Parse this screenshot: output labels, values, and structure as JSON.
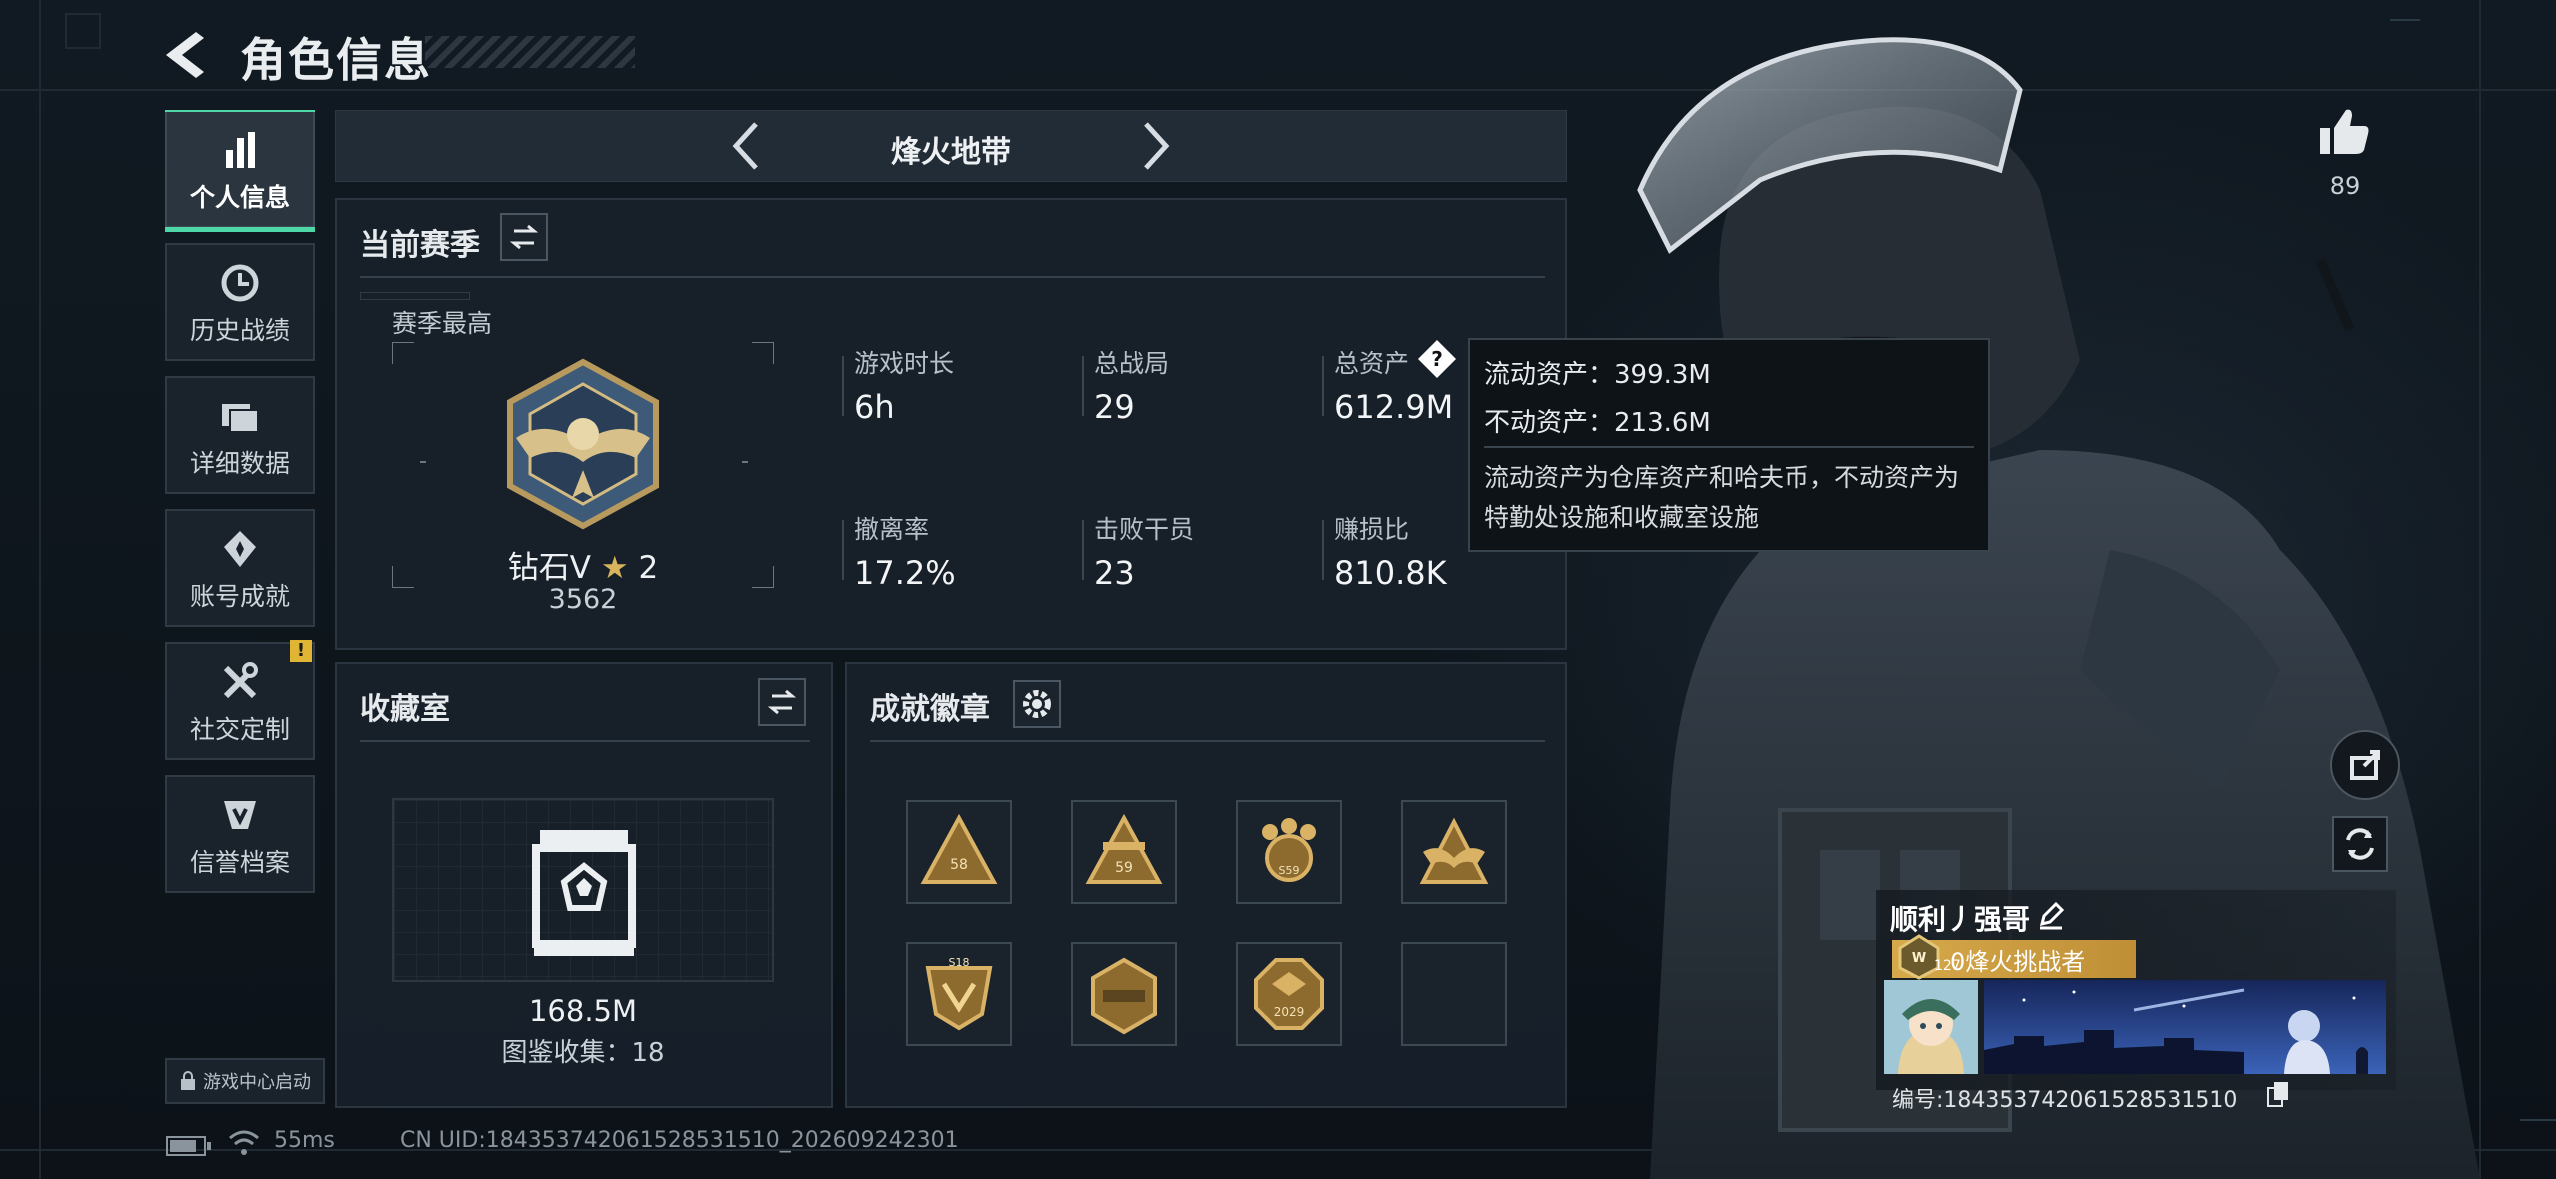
{
  "header": {
    "title": "角色信息"
  },
  "nav": {
    "items": [
      {
        "label": "个人信息"
      },
      {
        "label": "历史战绩"
      },
      {
        "label": "详细数据"
      },
      {
        "label": "账号成就"
      },
      {
        "label": "社交定制"
      },
      {
        "label": "信誉档案"
      }
    ],
    "alert": "!",
    "game_center": "游戏中心启动"
  },
  "mode": {
    "name": "烽火地带"
  },
  "season": {
    "title": "当前赛季",
    "best_label": "赛季最高",
    "rank_name": "钻石V",
    "rank_stars": "2",
    "rank_score": "3562",
    "stats": [
      {
        "label": "游戏时长",
        "value": "6h"
      },
      {
        "label": "总战局",
        "value": "29"
      },
      {
        "label": "总资产",
        "value": "612.9M"
      },
      {
        "label": "撤离率",
        "value": "17.2%"
      },
      {
        "label": "击败干员",
        "value": "23"
      },
      {
        "label": "赚损比",
        "value": "810.8K"
      }
    ]
  },
  "tooltip": {
    "liquid": "流动资产：399.3M",
    "fixed": "不动资产：213.6M",
    "note": "流动资产为仓库资产和哈夫币，不动资产为特勤处设施和收藏室设施"
  },
  "collection": {
    "title": "收藏室",
    "value": "168.5M",
    "count_label": "图鉴收集：18"
  },
  "achievements": {
    "title": "成就徽章",
    "badges": [
      "58",
      "59",
      "S59",
      "",
      "S18",
      "",
      "2029",
      ""
    ]
  },
  "player": {
    "name": "顺利丿强哥",
    "level": "127",
    "rank_title": "0烽火挑战者",
    "id_text": "编号:18435374206152853151​0"
  },
  "likes": {
    "count": "89"
  },
  "status": {
    "ping": "55ms",
    "uid": "CN UID:184353742061528531510_202609242301"
  },
  "colors": {
    "accent": "#4dd6a6",
    "gold": "#d6a94b",
    "panel": "#18212a"
  }
}
